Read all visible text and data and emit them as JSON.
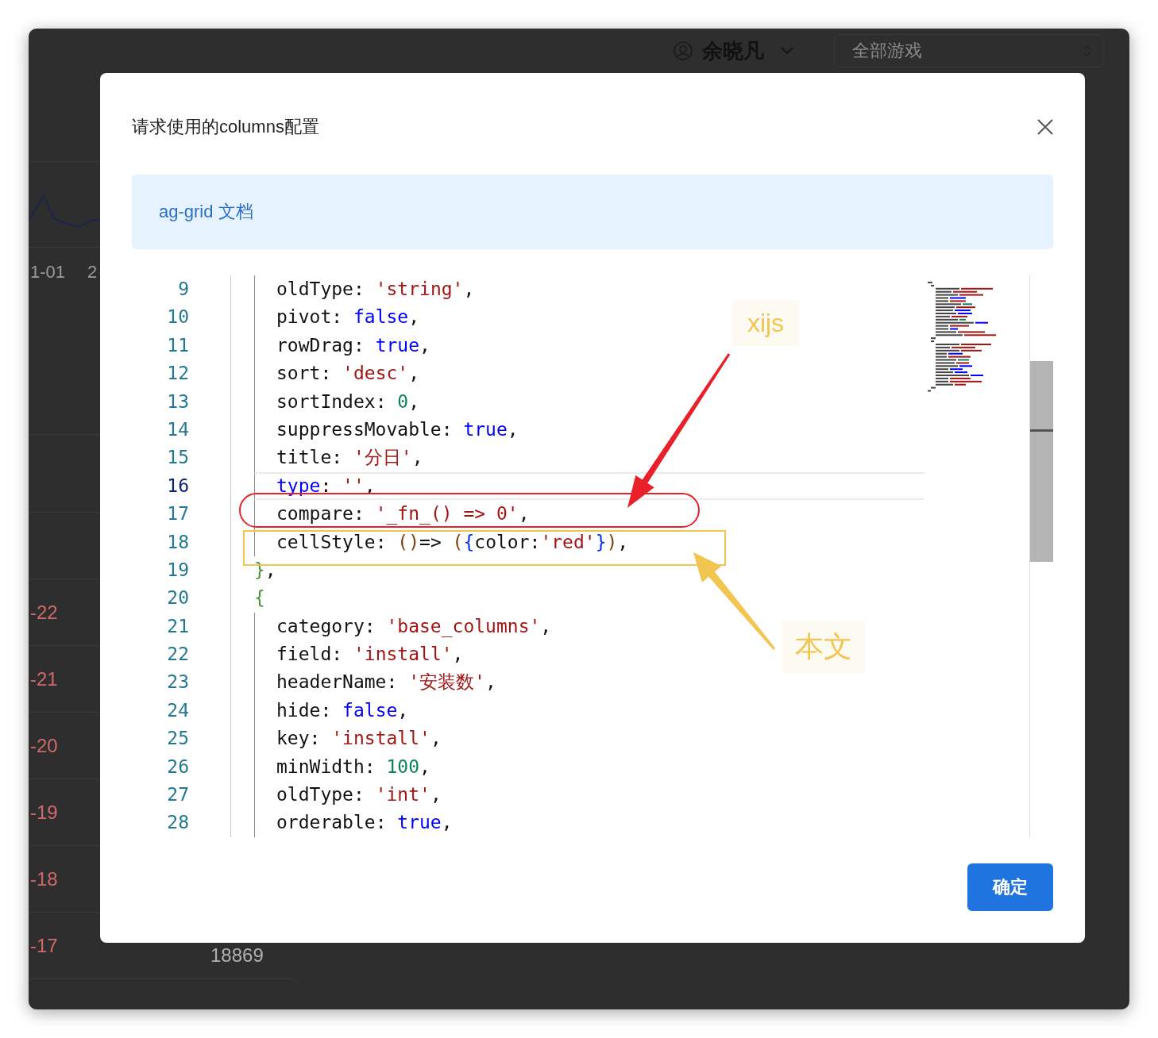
{
  "background_page": {
    "user": {
      "name": "余晓凡"
    },
    "game_select": {
      "value": "全部游戏"
    },
    "axis_labels": [
      "1-01",
      "2"
    ],
    "rows": [
      {
        "date": "-22"
      },
      {
        "date": "-21"
      },
      {
        "date": "-20"
      },
      {
        "date": "-19"
      },
      {
        "date": "-18"
      },
      {
        "date": "-17",
        "value": "18869"
      }
    ]
  },
  "dialog": {
    "title": "请求使用的columns配置",
    "alert": {
      "link": "ag-grid 文档"
    },
    "editor": {
      "lines": [
        {
          "number": "9",
          "kind": "property",
          "current": false,
          "tokens": [
            {
              "kind": "key",
              "text": "oldType"
            },
            {
              "kind": "punct",
              "text": ": "
            },
            {
              "kind": "string",
              "text": "'string'"
            },
            {
              "kind": "punct",
              "text": ","
            }
          ]
        },
        {
          "number": "10",
          "kind": "property",
          "current": false,
          "tokens": [
            {
              "kind": "key",
              "text": "pivot"
            },
            {
              "kind": "punct",
              "text": ": "
            },
            {
              "kind": "keyword",
              "text": "false"
            },
            {
              "kind": "punct",
              "text": ","
            }
          ]
        },
        {
          "number": "11",
          "kind": "property",
          "current": false,
          "tokens": [
            {
              "kind": "key",
              "text": "rowDrag"
            },
            {
              "kind": "punct",
              "text": ": "
            },
            {
              "kind": "keyword",
              "text": "true"
            },
            {
              "kind": "punct",
              "text": ","
            }
          ]
        },
        {
          "number": "12",
          "kind": "property",
          "current": false,
          "tokens": [
            {
              "kind": "key",
              "text": "sort"
            },
            {
              "kind": "punct",
              "text": ": "
            },
            {
              "kind": "string",
              "text": "'desc'"
            },
            {
              "kind": "punct",
              "text": ","
            }
          ]
        },
        {
          "number": "13",
          "kind": "property",
          "current": false,
          "tokens": [
            {
              "kind": "key",
              "text": "sortIndex"
            },
            {
              "kind": "punct",
              "text": ": "
            },
            {
              "kind": "number",
              "text": "0"
            },
            {
              "kind": "punct",
              "text": ","
            }
          ]
        },
        {
          "number": "14",
          "kind": "property",
          "current": false,
          "tokens": [
            {
              "kind": "key",
              "text": "suppressMovable"
            },
            {
              "kind": "punct",
              "text": ": "
            },
            {
              "kind": "keyword",
              "text": "true"
            },
            {
              "kind": "punct",
              "text": ","
            }
          ]
        },
        {
          "number": "15",
          "kind": "property",
          "current": false,
          "tokens": [
            {
              "kind": "key",
              "text": "title"
            },
            {
              "kind": "punct",
              "text": ": "
            },
            {
              "kind": "string",
              "text": "'分日'"
            },
            {
              "kind": "punct",
              "text": ","
            }
          ]
        },
        {
          "number": "16",
          "kind": "property",
          "current": true,
          "tokens": [
            {
              "kind": "keyword",
              "text": "type"
            },
            {
              "kind": "punct",
              "text": ": "
            },
            {
              "kind": "string",
              "text": "''"
            },
            {
              "kind": "punct",
              "text": ","
            }
          ]
        },
        {
          "number": "17",
          "kind": "property",
          "current": false,
          "tokens": [
            {
              "kind": "key",
              "text": "compare"
            },
            {
              "kind": "punct",
              "text": ": "
            },
            {
              "kind": "string",
              "text": "'_fn_() => 0'"
            },
            {
              "kind": "punct",
              "text": ","
            }
          ]
        },
        {
          "number": "18",
          "kind": "property",
          "current": false,
          "tokens": [
            {
              "kind": "key",
              "text": "cellStyle"
            },
            {
              "kind": "punct",
              "text": ": "
            },
            {
              "kind": "paren",
              "text": "()"
            },
            {
              "kind": "punct",
              "text": "=> "
            },
            {
              "kind": "paren",
              "text": "("
            },
            {
              "kind": "brace",
              "text": "{"
            },
            {
              "kind": "key",
              "text": "color:"
            },
            {
              "kind": "string",
              "text": "'red'"
            },
            {
              "kind": "brace",
              "text": "}"
            },
            {
              "kind": "paren",
              "text": ")"
            },
            {
              "kind": "punct",
              "text": ","
            }
          ]
        },
        {
          "number": "19",
          "kind": "brace",
          "current": false,
          "tokens": [
            {
              "kind": "outer",
              "text": "}"
            },
            {
              "kind": "punct",
              "text": ","
            }
          ]
        },
        {
          "number": "20",
          "kind": "brace",
          "current": false,
          "tokens": [
            {
              "kind": "outer",
              "text": "{"
            }
          ]
        },
        {
          "number": "21",
          "kind": "property",
          "current": false,
          "tokens": [
            {
              "kind": "key",
              "text": "category"
            },
            {
              "kind": "punct",
              "text": ": "
            },
            {
              "kind": "string",
              "text": "'base_columns'"
            },
            {
              "kind": "punct",
              "text": ","
            }
          ]
        },
        {
          "number": "22",
          "kind": "property",
          "current": false,
          "tokens": [
            {
              "kind": "key",
              "text": "field"
            },
            {
              "kind": "punct",
              "text": ": "
            },
            {
              "kind": "string",
              "text": "'install'"
            },
            {
              "kind": "punct",
              "text": ","
            }
          ]
        },
        {
          "number": "23",
          "kind": "property",
          "current": false,
          "tokens": [
            {
              "kind": "key",
              "text": "headerName"
            },
            {
              "kind": "punct",
              "text": ": "
            },
            {
              "kind": "string",
              "text": "'安装数'"
            },
            {
              "kind": "punct",
              "text": ","
            }
          ]
        },
        {
          "number": "24",
          "kind": "property",
          "current": false,
          "tokens": [
            {
              "kind": "key",
              "text": "hide"
            },
            {
              "kind": "punct",
              "text": ": "
            },
            {
              "kind": "keyword",
              "text": "false"
            },
            {
              "kind": "punct",
              "text": ","
            }
          ]
        },
        {
          "number": "25",
          "kind": "property",
          "current": false,
          "tokens": [
            {
              "kind": "key",
              "text": "key"
            },
            {
              "kind": "punct",
              "text": ": "
            },
            {
              "kind": "string",
              "text": "'install'"
            },
            {
              "kind": "punct",
              "text": ","
            }
          ]
        },
        {
          "number": "26",
          "kind": "property",
          "current": false,
          "tokens": [
            {
              "kind": "key",
              "text": "minWidth"
            },
            {
              "kind": "punct",
              "text": ": "
            },
            {
              "kind": "number",
              "text": "100"
            },
            {
              "kind": "punct",
              "text": ","
            }
          ]
        },
        {
          "number": "27",
          "kind": "property",
          "current": false,
          "tokens": [
            {
              "kind": "key",
              "text": "oldType"
            },
            {
              "kind": "punct",
              "text": ": "
            },
            {
              "kind": "string",
              "text": "'int'"
            },
            {
              "kind": "punct",
              "text": ","
            }
          ]
        },
        {
          "number": "28",
          "kind": "property",
          "current": false,
          "tokens": [
            {
              "kind": "key",
              "text": "orderable"
            },
            {
              "kind": "punct",
              "text": ": "
            },
            {
              "kind": "keyword",
              "text": "true"
            },
            {
              "kind": "punct",
              "text": ","
            }
          ]
        }
      ]
    },
    "button": "确定"
  },
  "annotations": [
    {
      "kind": "ellipse",
      "color": "#e8202a"
    },
    {
      "kind": "arrow",
      "color": "#e8202a"
    },
    {
      "kind": "label",
      "text": "xijs",
      "color": "#f2c450"
    },
    {
      "kind": "rect",
      "color": "#f2c450"
    },
    {
      "kind": "arrow",
      "color": "#f2c450"
    },
    {
      "kind": "label",
      "text": "本文",
      "color": "#f2c450"
    }
  ]
}
